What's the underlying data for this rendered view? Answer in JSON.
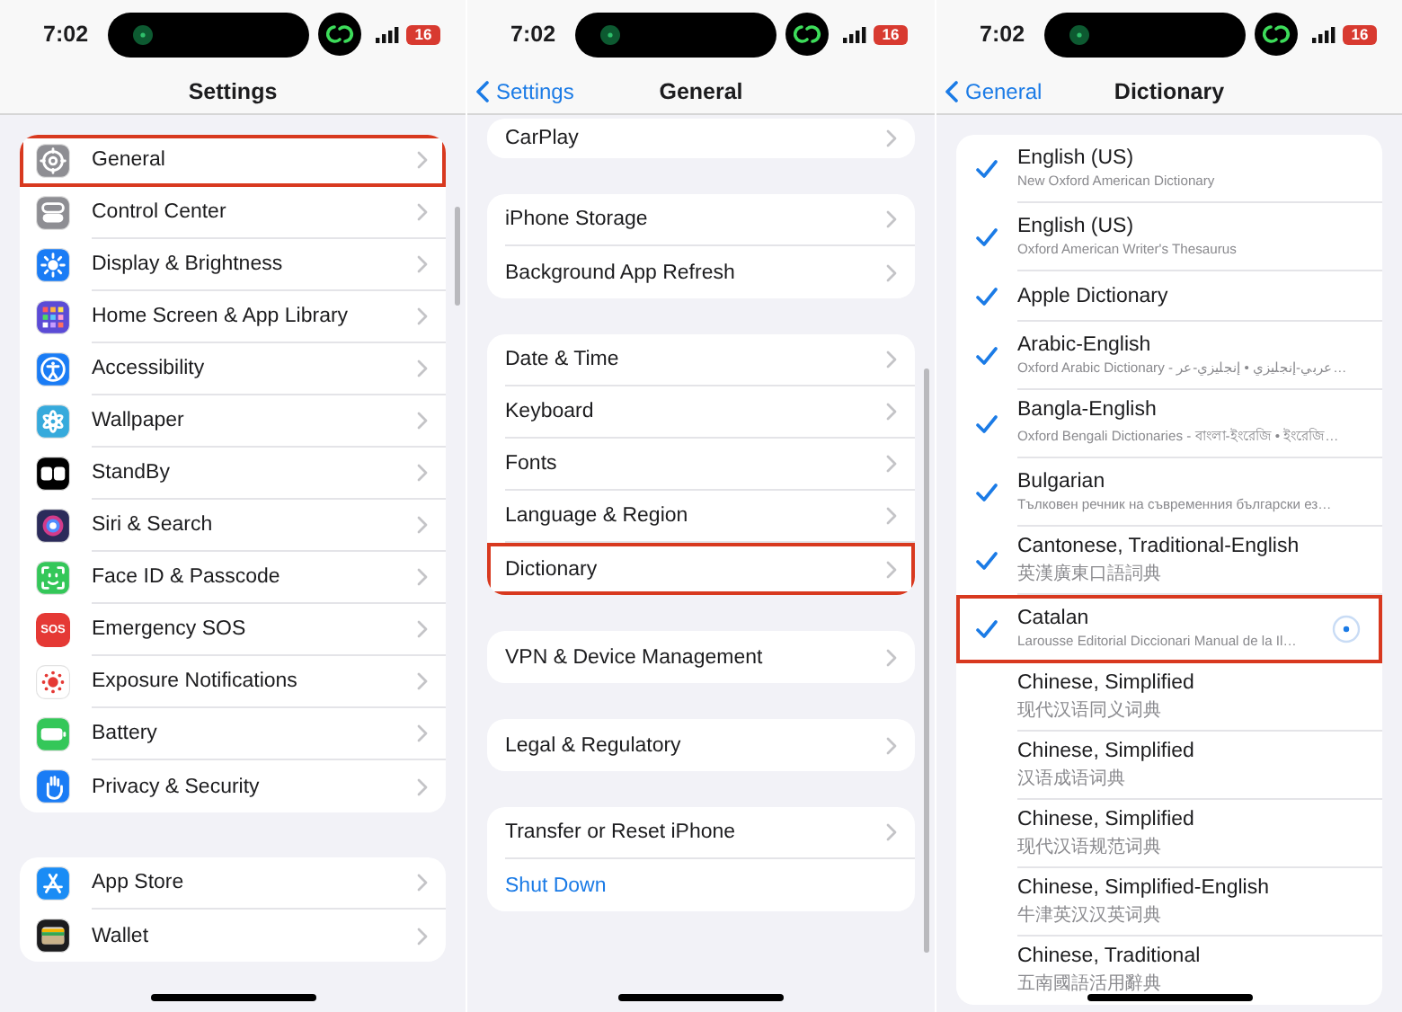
{
  "panels": [
    {
      "status": {
        "time": "7:02",
        "battery": "16"
      },
      "title": "Settings",
      "groups": [
        {
          "rows": [
            {
              "kind": "setting",
              "label": "General",
              "color": "#8e8e93",
              "highlighted": true
            },
            {
              "kind": "setting",
              "label": "Control Center",
              "color": "#8e8e93",
              "highlighted": false
            },
            {
              "kind": "setting",
              "label": "Display & Brightness",
              "color": "#1a7cf5",
              "highlighted": false
            },
            {
              "kind": "setting",
              "label": "Home Screen & App Library",
              "color": "#5b4bd6",
              "highlighted": false
            },
            {
              "kind": "setting",
              "label": "Accessibility",
              "color": "#1a7cf5",
              "highlighted": false
            },
            {
              "kind": "setting",
              "label": "Wallpaper",
              "color": "#36aadc",
              "highlighted": false
            },
            {
              "kind": "setting",
              "label": "StandBy",
              "color": "#000000",
              "highlighted": false
            },
            {
              "kind": "setting",
              "label": "Siri & Search",
              "color": "#2b2b5a",
              "highlighted": false
            },
            {
              "kind": "setting",
              "label": "Face ID & Passcode",
              "color": "#34c759",
              "highlighted": false
            },
            {
              "kind": "setting",
              "label": "Emergency SOS",
              "color": "#e53935",
              "icon_text": "SOS",
              "highlighted": false
            },
            {
              "kind": "setting",
              "label": "Exposure Notifications",
              "color": "#ffffff",
              "highlighted": false
            },
            {
              "kind": "setting",
              "label": "Battery",
              "color": "#34c759",
              "highlighted": false
            },
            {
              "kind": "setting",
              "label": "Privacy & Security",
              "color": "#1a7cf5",
              "highlighted": false
            }
          ]
        },
        {
          "rows": [
            {
              "kind": "setting",
              "label": "App Store",
              "color": "#1a8cf5",
              "highlighted": false
            },
            {
              "kind": "setting",
              "label": "Wallet",
              "color": "#1c1c1e",
              "highlighted": false
            }
          ]
        }
      ]
    },
    {
      "status": {
        "time": "7:02",
        "battery": "16"
      },
      "back": "Settings",
      "title": "General",
      "groups": [
        {
          "rows": [
            {
              "kind": "link",
              "label": "CarPlay",
              "highlighted": false
            }
          ]
        },
        {
          "rows": [
            {
              "kind": "link",
              "label": "iPhone Storage",
              "highlighted": false
            },
            {
              "kind": "link",
              "label": "Background App Refresh",
              "highlighted": false
            }
          ]
        },
        {
          "rows": [
            {
              "kind": "link",
              "label": "Date & Time",
              "highlighted": false
            },
            {
              "kind": "link",
              "label": "Keyboard",
              "highlighted": false
            },
            {
              "kind": "link",
              "label": "Fonts",
              "highlighted": false
            },
            {
              "kind": "link",
              "label": "Language & Region",
              "highlighted": false
            },
            {
              "kind": "link",
              "label": "Dictionary",
              "highlighted": true
            }
          ]
        },
        {
          "rows": [
            {
              "kind": "link",
              "label": "VPN & Device Management",
              "highlighted": false
            }
          ]
        },
        {
          "rows": [
            {
              "kind": "link",
              "label": "Legal & Regulatory",
              "highlighted": false
            }
          ]
        },
        {
          "rows": [
            {
              "kind": "link",
              "label": "Transfer or Reset iPhone",
              "highlighted": false
            },
            {
              "kind": "action",
              "label": "Shut Down",
              "highlighted": false
            }
          ]
        }
      ]
    },
    {
      "status": {
        "time": "7:02",
        "battery": "16"
      },
      "back": "General",
      "title": "Dictionary",
      "groups": [
        {
          "rows": [
            {
              "kind": "dictionary",
              "label": "English (US)",
              "subtitle": "New Oxford American Dictionary",
              "checked": true,
              "highlighted": false,
              "downloading": false
            },
            {
              "kind": "dictionary",
              "label": "English (US)",
              "subtitle": "Oxford American Writer's Thesaurus",
              "checked": true,
              "highlighted": false,
              "downloading": false
            },
            {
              "kind": "dictionary",
              "label": "Apple Dictionary",
              "checked": true,
              "highlighted": false,
              "downloading": false
            },
            {
              "kind": "dictionary",
              "label": "Arabic-English",
              "subtitle": "Oxford Arabic Dictionary - عربي-إنجليزي • إنجليزي-عر…",
              "checked": true,
              "highlighted": false,
              "downloading": false
            },
            {
              "kind": "dictionary",
              "label": "Bangla-English",
              "subtitle": "Oxford Bengali Dictionaries - বাংলা-ইংরেজি • ইংরেজি…",
              "checked": true,
              "highlighted": false,
              "downloading": false
            },
            {
              "kind": "dictionary",
              "label": "Bulgarian",
              "subtitle": "Тълковен речник на съвременния български ез…",
              "checked": true,
              "highlighted": false,
              "downloading": false
            },
            {
              "kind": "dictionary",
              "label": "Cantonese, Traditional-English",
              "subtitle": "英漢廣東口語詞典",
              "checked": true,
              "highlighted": false,
              "downloading": false
            },
            {
              "kind": "dictionary",
              "label": "Catalan",
              "subtitle": "Larousse Editorial Diccionari Manual de la Il…",
              "checked": true,
              "highlighted": true,
              "downloading": true
            },
            {
              "kind": "dictionary",
              "label": "Chinese, Simplified",
              "subtitle": "现代汉语同义词典",
              "checked": false,
              "highlighted": false,
              "downloading": false
            },
            {
              "kind": "dictionary",
              "label": "Chinese, Simplified",
              "subtitle": "汉语成语词典",
              "checked": false,
              "highlighted": false,
              "downloading": false
            },
            {
              "kind": "dictionary",
              "label": "Chinese, Simplified",
              "subtitle": "现代汉语规范词典",
              "checked": false,
              "highlighted": false,
              "downloading": false
            },
            {
              "kind": "dictionary",
              "label": "Chinese, Simplified-English",
              "subtitle": "牛津英汉汉英词典",
              "checked": false,
              "highlighted": false,
              "downloading": false
            },
            {
              "kind": "dictionary",
              "label": "Chinese, Traditional",
              "subtitle": "五南國語活用辭典",
              "checked": false,
              "highlighted": false,
              "downloading": false
            }
          ]
        }
      ]
    }
  ]
}
